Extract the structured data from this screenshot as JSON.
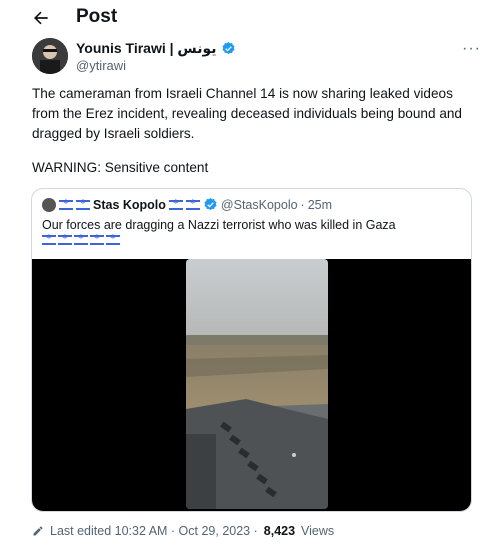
{
  "header": {
    "title": "Post",
    "back_icon": "arrow-left-icon"
  },
  "author": {
    "name": "Younis Tirawi | يونس",
    "handle": "@ytirawi",
    "verified_color": "#1d9bf0",
    "more_label": "···"
  },
  "tweet": {
    "text": "The cameraman from Israeli Channel 14 is now sharing leaked videos from the Erez incident, revealing deceased individuals being bound and dragged by Israeli soldiers.",
    "warning": "WARNING: Sensitive content"
  },
  "quote": {
    "name": "Stas Kopolo",
    "handle": "@StasKopolo",
    "separator": "·",
    "time": "25m",
    "text": "Our forces are dragging a Nazzi terrorist who was killed in Gaza",
    "flag_icon": "israel-flag-icon"
  },
  "footer": {
    "edited_label": "Last edited 10:32 AM · Oct 29, 2023 ·",
    "views_count": "8,423",
    "views_label": "Views"
  }
}
